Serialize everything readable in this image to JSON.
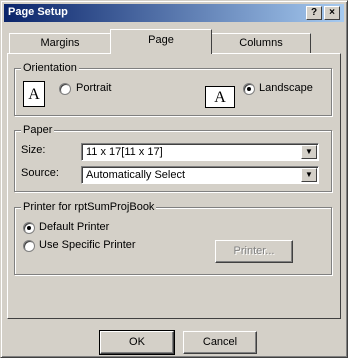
{
  "window": {
    "title": "Page Setup",
    "help_label": "?",
    "close_label": "×"
  },
  "tabs": [
    {
      "label": "Margins"
    },
    {
      "label": "Page"
    },
    {
      "label": "Columns"
    }
  ],
  "orientation": {
    "legend": "Orientation",
    "portrait_label": "Portrait",
    "landscape_label": "Landscape",
    "icon_letter": "A",
    "selected": "Landscape"
  },
  "paper": {
    "legend": "Paper",
    "size_label": "Size:",
    "size_value": "11 x 17[11 x 17]",
    "source_label": "Source:",
    "source_value": "Automatically Select"
  },
  "printer": {
    "legend": "Printer for rptSumProjBook",
    "default_label": "Default Printer",
    "specific_label": "Use Specific Printer",
    "printer_button": "Printer...",
    "selected": "Default Printer"
  },
  "footer": {
    "ok_label": "OK",
    "cancel_label": "Cancel"
  }
}
